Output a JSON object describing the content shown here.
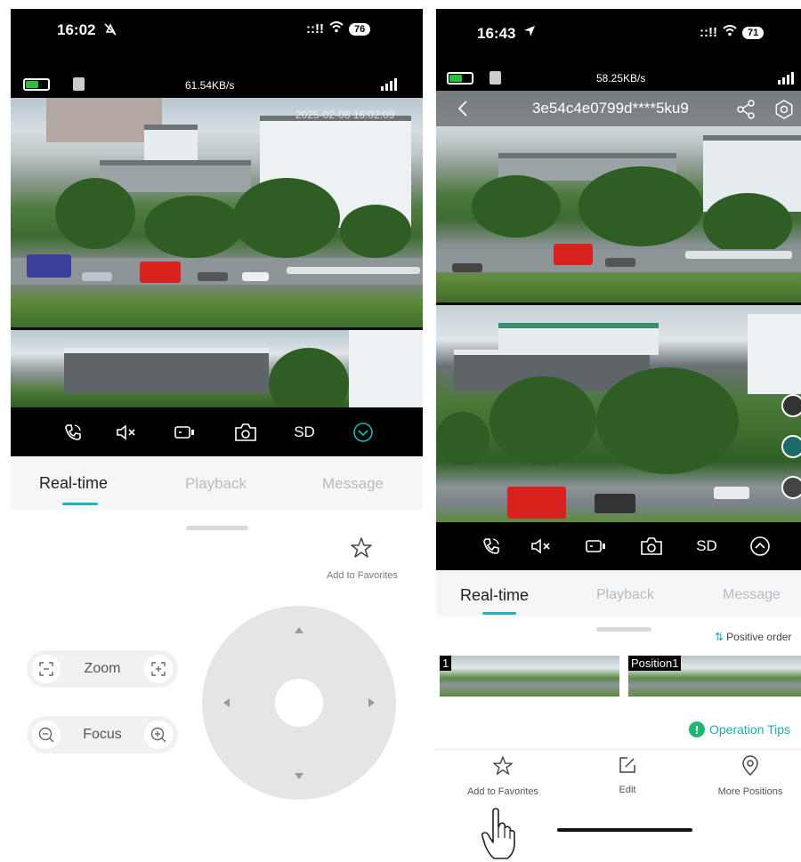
{
  "left": {
    "status": {
      "time": "16:02",
      "battery_level": "76",
      "network_speed": "61.54KB/s"
    },
    "feed": {
      "timestamp": "2025-02-08 16:02:09"
    },
    "controls": [
      "call-icon",
      "mute-icon",
      "record-icon",
      "snapshot-icon",
      "SD",
      "collapse-icon"
    ],
    "sd_label": "SD",
    "tabs": [
      "Real-time",
      "Playback",
      "Message"
    ],
    "favorites_label": "Add to Favorites",
    "zoom_label": "Zoom",
    "focus_label": "Focus"
  },
  "right": {
    "status": {
      "time": "16:43",
      "battery_level": "71",
      "network_speed": "58.25KB/s"
    },
    "device_name": "3e54c4e0799d****5ku9",
    "sd_label": "SD",
    "tabs": [
      "Real-time",
      "Playback",
      "Message"
    ],
    "positive_order_label": "Positive order",
    "positions": [
      {
        "label": "1"
      },
      {
        "label": "Position1"
      }
    ],
    "operation_tips_label": "Operation Tips",
    "bottom_actions": [
      {
        "label": "Add to Favorites",
        "icon": "star-icon"
      },
      {
        "label": "Edit",
        "icon": "edit-icon"
      },
      {
        "label": "More Positions",
        "icon": "location-pin-icon"
      }
    ]
  },
  "colors": {
    "accent": "#1fb5b8",
    "battery_green": "#22c33a",
    "control_bar": "#000000"
  }
}
